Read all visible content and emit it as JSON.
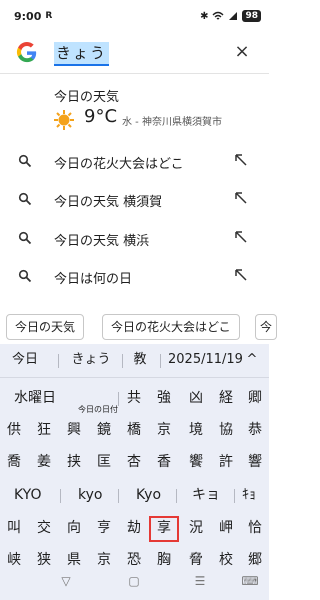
{
  "status_bar": {
    "time": "9:00",
    "carrier_icon": "R",
    "battery": "98"
  },
  "search": {
    "query": "きょう",
    "clear_label": "×"
  },
  "weather": {
    "title": "今日の天気",
    "temp": "9°C",
    "location": "水 - 神奈川県横須賀市"
  },
  "suggestions": [
    "今日の花火大会はどこ",
    "今日の天気 横須賀",
    "今日の天気 横浜",
    "今日は何の日"
  ],
  "chips": [
    "今日の天気",
    "今日の花火大会はどこ",
    "今"
  ],
  "kb_top": [
    "今日",
    "きょう",
    "教",
    "2025/11/19",
    "^"
  ],
  "candidates": [
    [
      "水曜日",
      "共",
      "強",
      "凶",
      "経",
      "卿"
    ],
    [
      "供",
      "狂",
      "興",
      "鏡",
      "橋",
      "京",
      "境",
      "協",
      "恭"
    ],
    [
      "喬",
      "姜",
      "挟",
      "匡",
      "杏",
      "香",
      "饗",
      "許",
      "響"
    ],
    [
      "KYO",
      "kyo",
      "Kyo",
      "キョ",
      "ｷｮ"
    ],
    [
      "叫",
      "交",
      "向",
      "亨",
      "劫",
      "享",
      "況",
      "岬",
      "恰"
    ],
    [
      "峡",
      "狭",
      "県",
      "京",
      "恐",
      "胸",
      "脅",
      "校",
      "郷"
    ]
  ],
  "today_date_label": "今日の日付",
  "navbar": [
    "▽",
    "▢",
    "☰",
    "⌨"
  ]
}
